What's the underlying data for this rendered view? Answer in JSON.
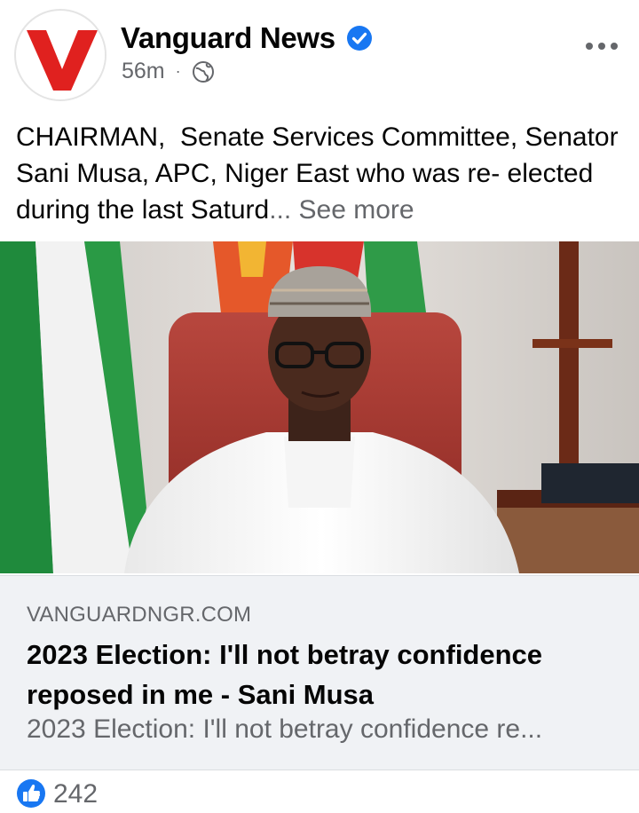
{
  "post": {
    "page_name": "Vanguard News",
    "timestamp": "56m",
    "separator": "·",
    "audience_icon": "globe-icon",
    "options_icon": "more-options-icon",
    "text": "CHAIRMAN,  Senate Services Committee, Senator Sani Musa, APC, Niger East who was re- elected during the last Saturd",
    "ellipsis": "...",
    "see_more": "See more"
  },
  "link_preview": {
    "domain": "VANGUARDNGR.COM",
    "title": "2023 Election: I'll not betray confidence reposed in me - Sani Musa",
    "description": "2023 Election: I'll not betray confidence re..."
  },
  "reactions": {
    "icon": "like-icon",
    "count": "242"
  },
  "colors": {
    "brand_red": "#e0211f",
    "verified_blue": "#1877f2",
    "secondary_text": "#65676b",
    "card_bg": "#f0f2f5"
  }
}
